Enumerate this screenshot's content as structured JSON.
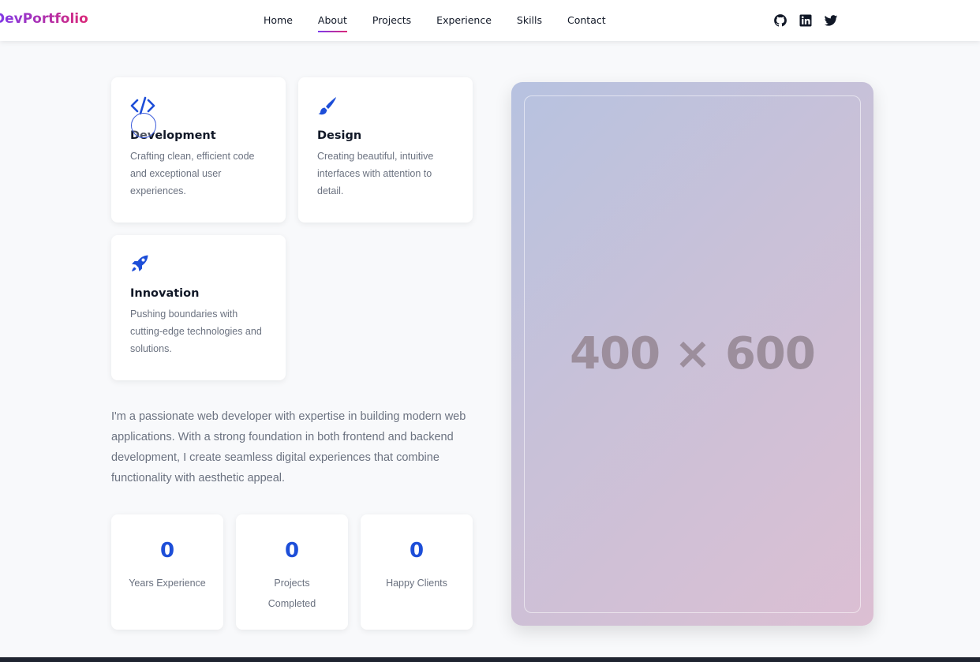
{
  "brand": "DevPortfolio",
  "nav": {
    "items": [
      "Home",
      "About",
      "Projects",
      "Experience",
      "Skills",
      "Contact"
    ],
    "active": "About"
  },
  "socials": [
    "github-icon",
    "linkedin-icon",
    "twitter-icon"
  ],
  "features": [
    {
      "icon": "code-icon",
      "title": "Development",
      "text": "Crafting clean, efficient code and exceptional user experiences."
    },
    {
      "icon": "paintbrush-icon",
      "title": "Design",
      "text": "Creating beautiful, intuitive interfaces with attention to detail."
    },
    {
      "icon": "rocket-icon",
      "title": "Innovation",
      "text": "Pushing boundaries with cutting-edge technologies and solutions."
    }
  ],
  "about": "I'm a passionate web developer with expertise in building modern web applications. With a strong foundation in both frontend and backend development, I create seamless digital experiences that combine functionality with aesthetic appeal.",
  "stats": [
    {
      "value": "0",
      "label": "Years Experience"
    },
    {
      "value": "0",
      "label": "Projects Completed"
    },
    {
      "value": "0",
      "label": "Happy Clients"
    }
  ],
  "image_placeholder": "400 × 600",
  "colors": {
    "accent": "#1d4ed8",
    "brand_start": "#7c3aed",
    "brand_end": "#db2777"
  }
}
